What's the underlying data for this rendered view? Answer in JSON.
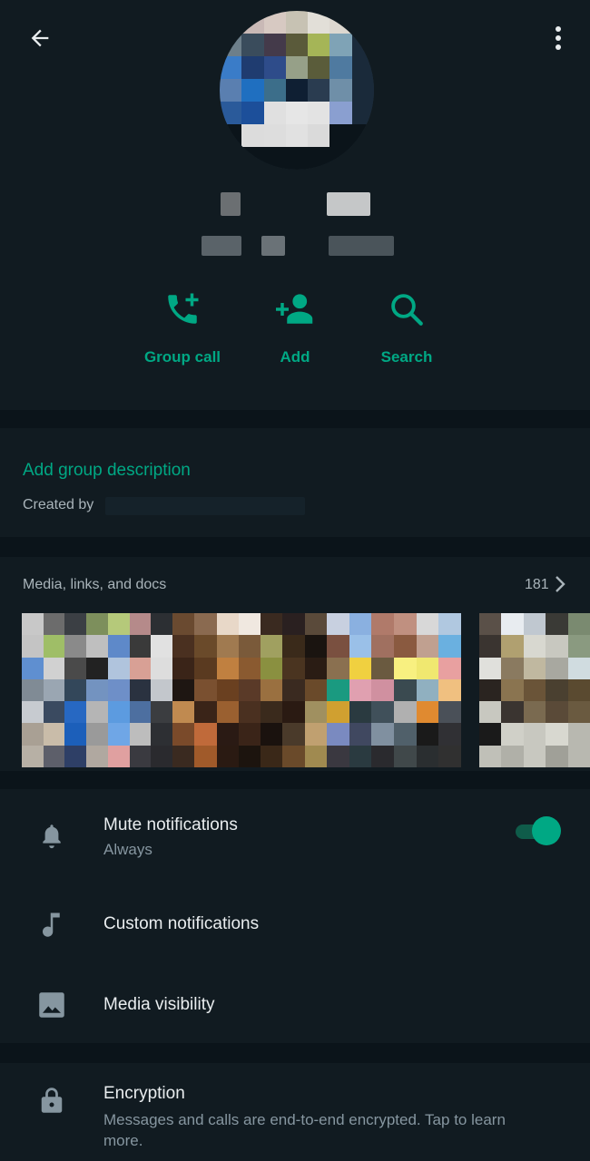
{
  "header": {
    "back_icon": "arrow-left-icon",
    "menu_icon": "more-vertical-icon"
  },
  "actions": [
    {
      "label": "Group call",
      "icon": "phone-plus-icon"
    },
    {
      "label": "Add",
      "icon": "person-add-icon"
    },
    {
      "label": "Search",
      "icon": "search-icon"
    }
  ],
  "description": {
    "add_label": "Add group description",
    "created_by_label": "Created by"
  },
  "media": {
    "title": "Media, links, and docs",
    "count": "181"
  },
  "settings": {
    "mute": {
      "title": "Mute notifications",
      "subtitle": "Always",
      "enabled": true,
      "icon": "bell-icon"
    },
    "custom": {
      "title": "Custom notifications",
      "icon": "music-note-icon"
    },
    "visibility": {
      "title": "Media visibility",
      "icon": "image-icon"
    }
  },
  "encryption": {
    "title": "Encryption",
    "subtitle": "Messages and calls are end-to-end encrypted. Tap to learn more.",
    "icon": "lock-icon"
  },
  "colors": {
    "accent": "#00a884",
    "background": "#0b141a",
    "surface": "#111b21"
  }
}
